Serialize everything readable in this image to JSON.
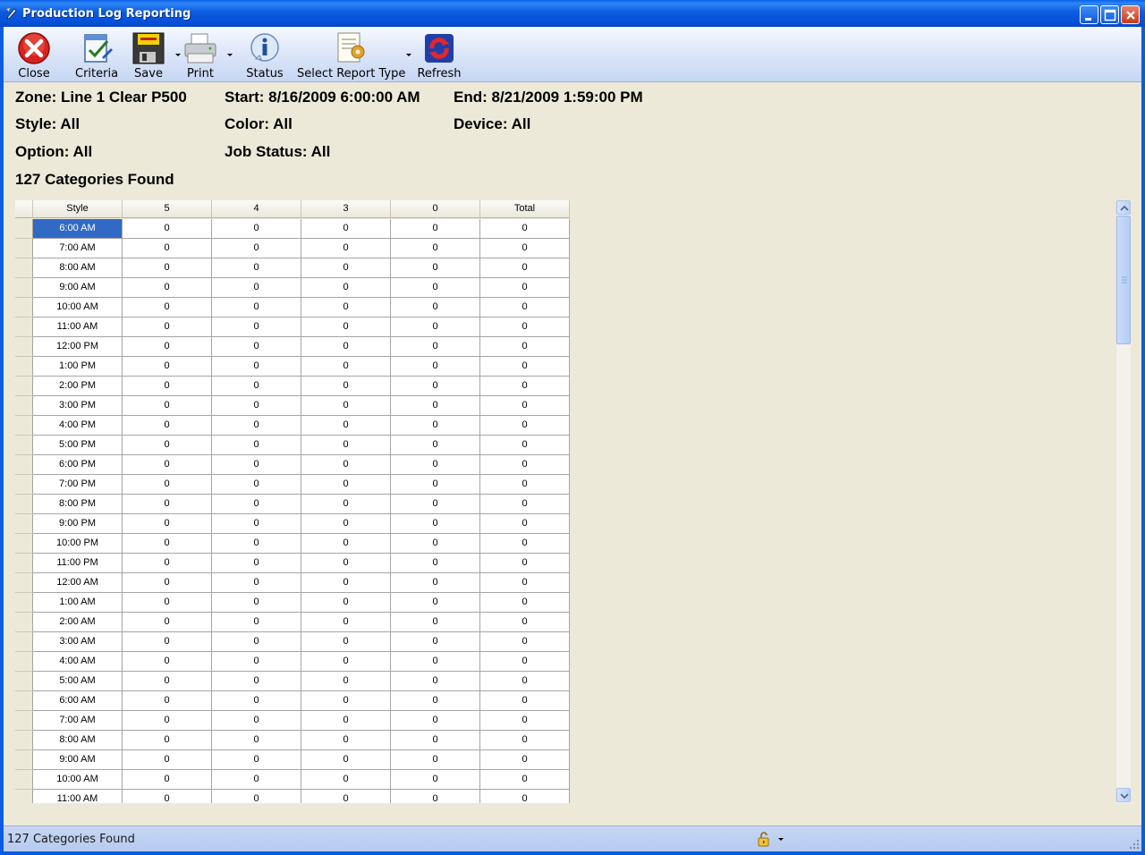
{
  "window": {
    "title": "Production Log Reporting"
  },
  "toolbar": {
    "close_label": "Close",
    "criteria_label": "Criteria",
    "save_label": "Save",
    "print_label": "Print",
    "status_label": "Status",
    "report_type_label": "Select Report Type",
    "refresh_label": "Refresh"
  },
  "info": {
    "zone": "Zone: Line 1 Clear P500",
    "start": "Start: 8/16/2009 6:00:00 AM",
    "end": "End: 8/21/2009 1:59:00 PM",
    "style": "Style: All",
    "color": "Color: All",
    "device": "Device: All",
    "option": "Option: All",
    "job_status": "Job Status: All",
    "count": "127 Categories Found"
  },
  "grid": {
    "columns": [
      "Style",
      "5",
      "4",
      "3",
      "0",
      "Total"
    ],
    "rows": [
      [
        "6:00 AM",
        "0",
        "0",
        "0",
        "0",
        "0"
      ],
      [
        "7:00 AM",
        "0",
        "0",
        "0",
        "0",
        "0"
      ],
      [
        "8:00 AM",
        "0",
        "0",
        "0",
        "0",
        "0"
      ],
      [
        "9:00 AM",
        "0",
        "0",
        "0",
        "0",
        "0"
      ],
      [
        "10:00 AM",
        "0",
        "0",
        "0",
        "0",
        "0"
      ],
      [
        "11:00 AM",
        "0",
        "0",
        "0",
        "0",
        "0"
      ],
      [
        "12:00 PM",
        "0",
        "0",
        "0",
        "0",
        "0"
      ],
      [
        "1:00 PM",
        "0",
        "0",
        "0",
        "0",
        "0"
      ],
      [
        "2:00 PM",
        "0",
        "0",
        "0",
        "0",
        "0"
      ],
      [
        "3:00 PM",
        "0",
        "0",
        "0",
        "0",
        "0"
      ],
      [
        "4:00 PM",
        "0",
        "0",
        "0",
        "0",
        "0"
      ],
      [
        "5:00 PM",
        "0",
        "0",
        "0",
        "0",
        "0"
      ],
      [
        "6:00 PM",
        "0",
        "0",
        "0",
        "0",
        "0"
      ],
      [
        "7:00 PM",
        "0",
        "0",
        "0",
        "0",
        "0"
      ],
      [
        "8:00 PM",
        "0",
        "0",
        "0",
        "0",
        "0"
      ],
      [
        "9:00 PM",
        "0",
        "0",
        "0",
        "0",
        "0"
      ],
      [
        "10:00 PM",
        "0",
        "0",
        "0",
        "0",
        "0"
      ],
      [
        "11:00 PM",
        "0",
        "0",
        "0",
        "0",
        "0"
      ],
      [
        "12:00 AM",
        "0",
        "0",
        "0",
        "0",
        "0"
      ],
      [
        "1:00 AM",
        "0",
        "0",
        "0",
        "0",
        "0"
      ],
      [
        "2:00 AM",
        "0",
        "0",
        "0",
        "0",
        "0"
      ],
      [
        "3:00 AM",
        "0",
        "0",
        "0",
        "0",
        "0"
      ],
      [
        "4:00 AM",
        "0",
        "0",
        "0",
        "0",
        "0"
      ],
      [
        "5:00 AM",
        "0",
        "0",
        "0",
        "0",
        "0"
      ],
      [
        "6:00 AM",
        "0",
        "0",
        "0",
        "0",
        "0"
      ],
      [
        "7:00 AM",
        "0",
        "0",
        "0",
        "0",
        "0"
      ],
      [
        "8:00 AM",
        "0",
        "0",
        "0",
        "0",
        "0"
      ],
      [
        "9:00 AM",
        "0",
        "0",
        "0",
        "0",
        "0"
      ],
      [
        "10:00 AM",
        "0",
        "0",
        "0",
        "0",
        "0"
      ],
      [
        "11:00 AM",
        "0",
        "0",
        "0",
        "0",
        "0"
      ]
    ],
    "selected_row": 0
  },
  "statusbar": {
    "text": "127 Categories Found"
  },
  "colors": {
    "titlebar": "#0A5DE0",
    "selection": "#316AC5",
    "toolbar": "#DCE6F8"
  },
  "icons": [
    "app-icon",
    "close-icon",
    "criteria-icon",
    "save-icon",
    "print-icon",
    "status-icon",
    "report-type-icon",
    "refresh-icon",
    "lock-icon"
  ]
}
